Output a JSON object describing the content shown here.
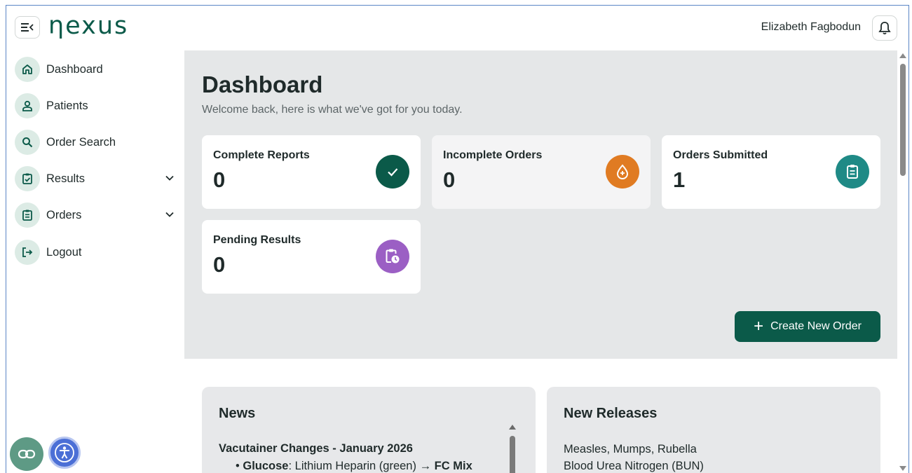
{
  "app": {
    "logo_text": "ηexus",
    "brand_color": "#0b5a49"
  },
  "header": {
    "user_name": "Elizabeth Fagbodun"
  },
  "sidebar": {
    "items": [
      {
        "label": "Dashboard",
        "icon": "home-icon"
      },
      {
        "label": "Patients",
        "icon": "user-icon"
      },
      {
        "label": "Order Search",
        "icon": "search-icon"
      },
      {
        "label": "Results",
        "icon": "clipboard-check-icon",
        "expandable": true
      },
      {
        "label": "Orders",
        "icon": "clipboard-list-icon",
        "expandable": true
      },
      {
        "label": "Logout",
        "icon": "logout-icon"
      }
    ]
  },
  "dashboard": {
    "title": "Dashboard",
    "subtitle": "Welcome back, here is what we've got for you today.",
    "cards": [
      {
        "label": "Complete Reports",
        "value": "0",
        "icon": "check-icon",
        "color": "#0b5a49"
      },
      {
        "label": "Incomplete Orders",
        "value": "0",
        "icon": "blood-drop-icon",
        "color": "#e07b22"
      },
      {
        "label": "Orders Submitted",
        "value": "1",
        "icon": "clipboard-icon",
        "color": "#1f8a86"
      },
      {
        "label": "Pending Results",
        "value": "0",
        "icon": "clipboard-clock-icon",
        "color": "#9b5fc4"
      }
    ],
    "create_button": "Create New Order"
  },
  "news": {
    "title": "News",
    "heading": "Vacutainer Changes - January 2026",
    "bullet_bold": "Glucose",
    "bullet_text": ": Lithium Heparin (green) → ",
    "bullet_bold2": "FC Mix"
  },
  "releases": {
    "title": "New Releases",
    "items": [
      "Measles, Mumps, Rubella",
      "Blood Urea Nitrogen (BUN)"
    ]
  }
}
